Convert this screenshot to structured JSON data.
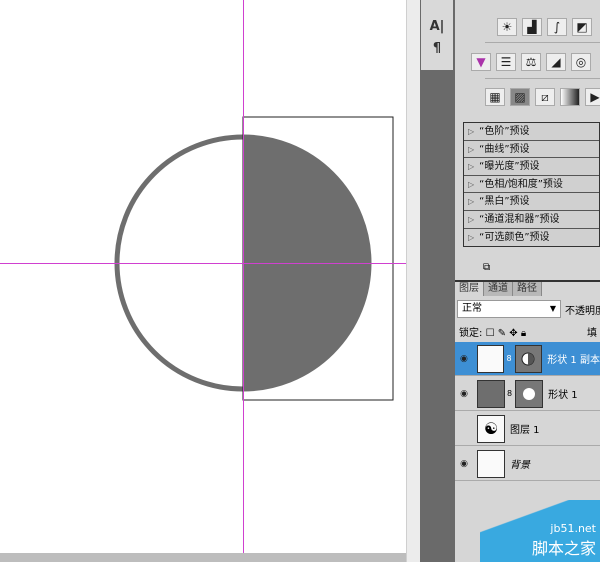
{
  "char_panel": {
    "items": [
      {
        "icon": "character-icon",
        "label": "A|"
      },
      {
        "icon": "paragraph-icon",
        "label": "¶"
      }
    ]
  },
  "adjustments": {
    "row1": [
      "brightness-contrast-icon",
      "levels-icon",
      "curves-icon",
      "exposure-icon"
    ],
    "row2": [
      "vibrance-icon",
      "hue-saturation-icon",
      "color-balance-icon",
      "black-white-icon",
      "photo-filter-icon"
    ],
    "row3": [
      "channel-mixer-icon",
      "invert-icon",
      "posterize-icon",
      "gradient-map-icon",
      "selective-color-icon"
    ],
    "presets": [
      "“色阶”预设",
      "“曲线”预设",
      "“曝光度”预设",
      "“色相/饱和度”预设",
      "“黑白”预设",
      "“通道混和器”预设",
      "“可选颜色”预设"
    ]
  },
  "layers_panel": {
    "tabs": [
      "图层",
      "通道",
      "路径"
    ],
    "blend_mode": "正常",
    "opacity_label": "不透明度",
    "lock_label": "锁定:",
    "fill_label": "填充",
    "layers": [
      {
        "name": "形状 1 副本",
        "visible": true,
        "selected": true
      },
      {
        "name": "形状 1",
        "visible": true,
        "selected": false
      },
      {
        "name": "图层 1",
        "visible": false,
        "selected": false
      },
      {
        "name": "背景",
        "visible": true,
        "selected": false
      }
    ]
  },
  "watermark": {
    "line1": "jb51.net",
    "line2": "脚本之家"
  },
  "colors": {
    "guide": "#d040d0",
    "shape_fill": "#6e6e6e",
    "selection": "#3d8fd4"
  }
}
